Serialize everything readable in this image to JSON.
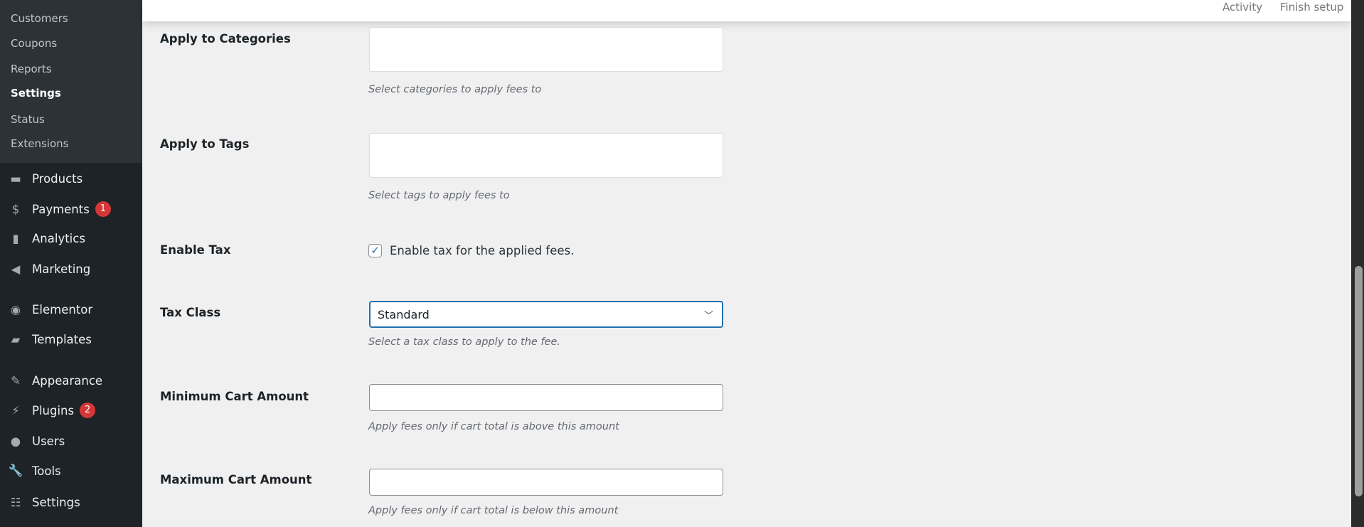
{
  "sidebar": {
    "submenu": [
      "Customers",
      "Coupons",
      "Reports",
      "Settings",
      "Status",
      "Extensions"
    ],
    "active_submenu": "Settings",
    "menu": [
      {
        "label": "Products",
        "icon": "archive-icon"
      },
      {
        "label": "Payments",
        "icon": "dollar-icon",
        "badge": "1"
      },
      {
        "label": "Analytics",
        "icon": "bar-chart-icon"
      },
      {
        "label": "Marketing",
        "icon": "megaphone-icon"
      },
      {
        "label": "Elementor",
        "icon": "elementor-icon"
      },
      {
        "label": "Templates",
        "icon": "folder-icon"
      },
      {
        "label": "Appearance",
        "icon": "paintbrush-icon"
      },
      {
        "label": "Plugins",
        "icon": "plugin-icon",
        "badge": "2"
      },
      {
        "label": "Users",
        "icon": "user-icon"
      },
      {
        "label": "Tools",
        "icon": "wrench-icon"
      },
      {
        "label": "Settings",
        "icon": "sliders-icon"
      }
    ]
  },
  "header": {
    "activity": "Activity",
    "finish_setup": "Finish setup"
  },
  "form": {
    "categories": {
      "label": "Apply to Categories",
      "hint": "Select categories to apply fees to"
    },
    "tags": {
      "label": "Apply to Tags",
      "hint": "Select tags to apply fees to"
    },
    "tax": {
      "label": "Enable Tax",
      "checkbox_label": "Enable tax for the applied fees.",
      "checked": true
    },
    "tax_class": {
      "label": "Tax Class",
      "value": "Standard",
      "hint": "Select a tax class to apply to the fee."
    },
    "min_cart": {
      "label": "Minimum Cart Amount",
      "value": "",
      "hint": "Apply fees only if cart total is above this amount"
    },
    "max_cart": {
      "label": "Maximum Cart Amount",
      "value": "",
      "hint": "Apply fees only if cart total is below this amount"
    }
  },
  "colors": {
    "sidebar": "#1d2327",
    "submenu": "#2c3338",
    "accent": "#2271b1",
    "badge": "#d63638"
  }
}
